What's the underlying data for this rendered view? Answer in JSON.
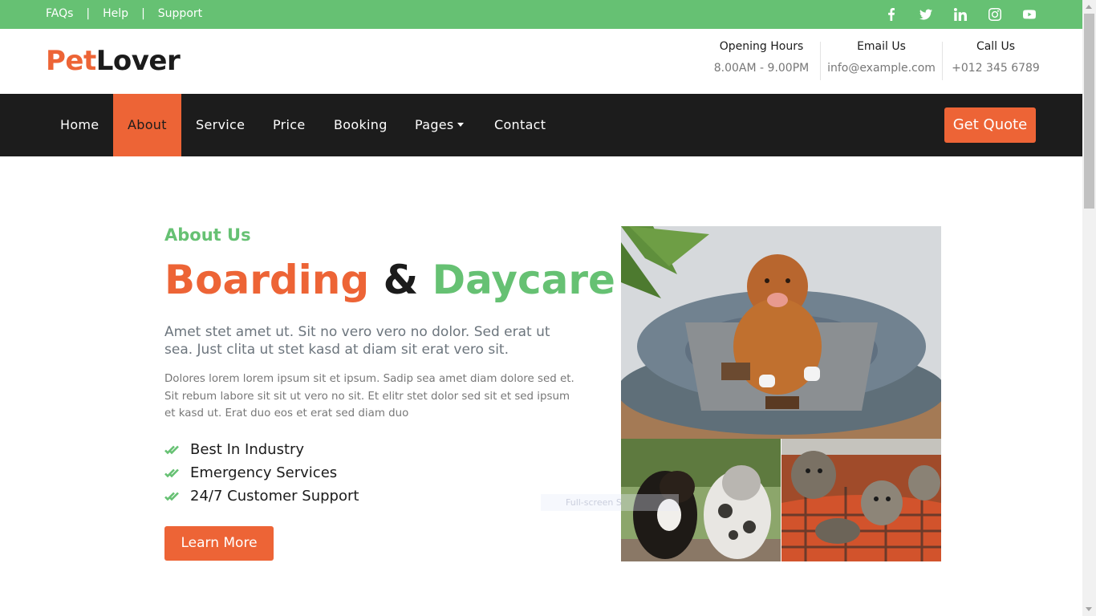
{
  "topbar": {
    "links": [
      "FAQs",
      "Help",
      "Support"
    ],
    "separator": "|",
    "social": [
      "facebook-icon",
      "twitter-icon",
      "linkedin-icon",
      "instagram-icon",
      "youtube-icon"
    ],
    "color": "#66c173"
  },
  "header": {
    "logo_part1": "Pet",
    "logo_part2": "Lover",
    "opening_title": "Opening Hours",
    "opening_value": "8.00AM - 9.00PM",
    "email_title": "Email Us",
    "email_value": "info@example.com",
    "call_title": "Call Us",
    "call_value": "+012 345 6789"
  },
  "nav": {
    "items": [
      "Home",
      "About",
      "Service",
      "Price",
      "Booking",
      "Pages",
      "Contact"
    ],
    "active": "About",
    "cta": "Get Quote"
  },
  "about": {
    "eyebrow": "About Us",
    "headline_1": "Boarding",
    "headline_2": "&",
    "headline_3": "Daycare",
    "lead": "Amet stet amet ut. Sit no vero vero no dolor. Sed erat ut sea. Just clita ut stet kasd at diam sit erat vero sit.",
    "body": "Dolores lorem lorem ipsum sit et ipsum. Sadip sea amet diam dolore sed et. Sit rebum labore sit sit ut vero no sit. Et elitr stet dolor sed sit et sed ipsum et kasd ut. Erat duo eos et erat sed diam duo",
    "features": [
      "Best In Industry",
      "Emergency Services",
      "24/7 Customer Support"
    ],
    "button": "Learn More"
  },
  "overlay_hint": "Full-screen S",
  "colors": {
    "accent": "#ed6436",
    "green": "#66c173",
    "dark": "#1c1c1c"
  }
}
